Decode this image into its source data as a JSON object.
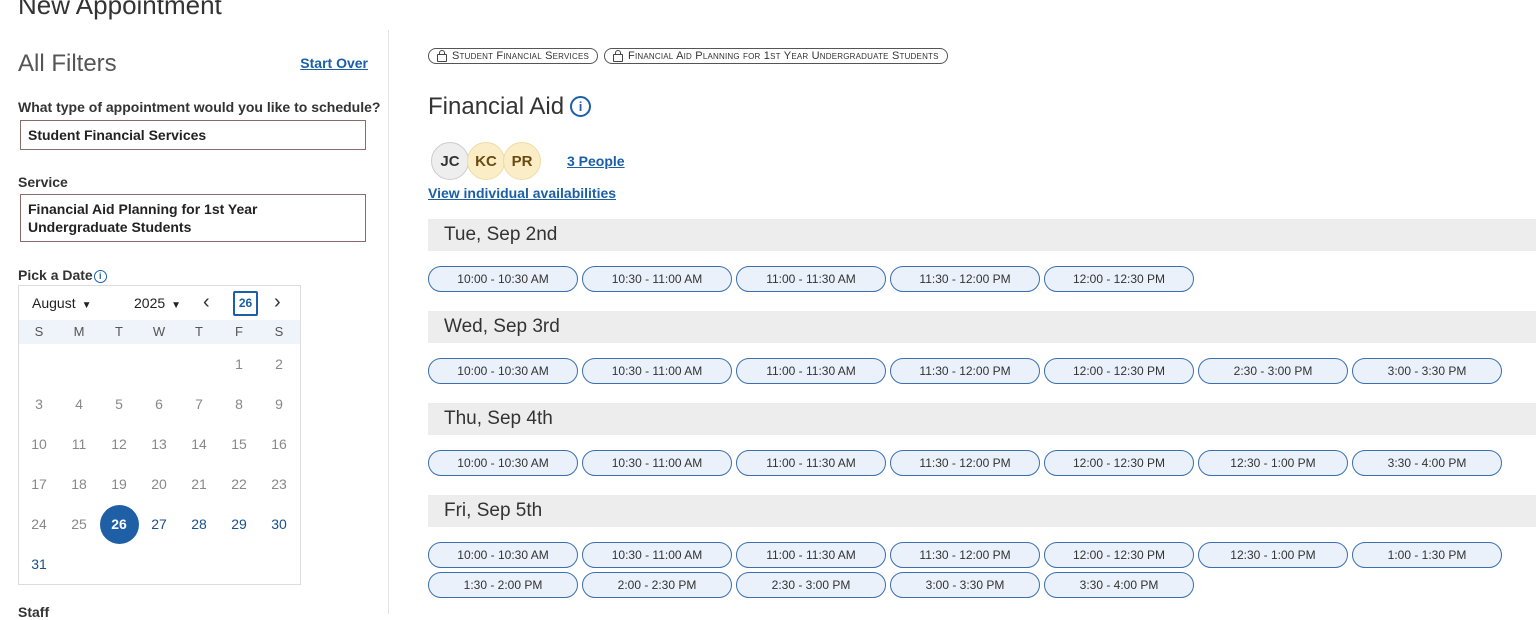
{
  "page_title": "New Appointment",
  "sidebar": {
    "filters_title": "All Filters",
    "start_over": "Start Over",
    "appointment_type_label": "What type of appointment would you like to schedule?",
    "appointment_type_value": "Student Financial Services",
    "service_label": "Service",
    "service_value": "Financial Aid Planning for 1st Year Undergraduate Students",
    "date_label": "Pick a Date",
    "staff_label": "Staff"
  },
  "calendar": {
    "month": "August",
    "year": "2025",
    "today": "26",
    "weekdays": [
      "S",
      "M",
      "T",
      "W",
      "T",
      "F",
      "S"
    ],
    "selected": 26,
    "available_from": 26,
    "days_in_month": 31,
    "first_weekday_index": 5
  },
  "main": {
    "chips": [
      "Student Financial Services",
      "Financial Aid Planning for 1st Year Undergraduate Students"
    ],
    "title": "Financial Aid",
    "avatars": [
      "JC",
      "KC",
      "PR"
    ],
    "people_link": "3 People",
    "view_link": "View individual availabilities",
    "days": [
      {
        "label": "Tue, Sep 2nd",
        "slots": [
          "10:00 - 10:30 AM",
          "10:30 - 11:00 AM",
          "11:00 - 11:30 AM",
          "11:30 - 12:00 PM",
          "12:00 - 12:30 PM"
        ]
      },
      {
        "label": "Wed, Sep 3rd",
        "slots": [
          "10:00 - 10:30 AM",
          "10:30 - 11:00 AM",
          "11:00 - 11:30 AM",
          "11:30 - 12:00 PM",
          "12:00 - 12:30 PM",
          "2:30 - 3:00 PM",
          "3:00 - 3:30 PM"
        ]
      },
      {
        "label": "Thu, Sep 4th",
        "slots": [
          "10:00 - 10:30 AM",
          "10:30 - 11:00 AM",
          "11:00 - 11:30 AM",
          "11:30 - 12:00 PM",
          "12:00 - 12:30 PM",
          "12:30 - 1:00 PM",
          "3:30 - 4:00 PM"
        ]
      },
      {
        "label": "Fri, Sep 5th",
        "slots": [
          "10:00 - 10:30 AM",
          "10:30 - 11:00 AM",
          "11:00 - 11:30 AM",
          "11:30 - 12:00 PM",
          "12:00 - 12:30 PM",
          "12:30 - 1:00 PM",
          "1:00 - 1:30 PM",
          "1:30 - 2:00 PM",
          "2:00 - 2:30 PM",
          "2:30 - 3:00 PM",
          "3:00 - 3:30 PM",
          "3:30 - 4:00 PM"
        ]
      }
    ]
  }
}
